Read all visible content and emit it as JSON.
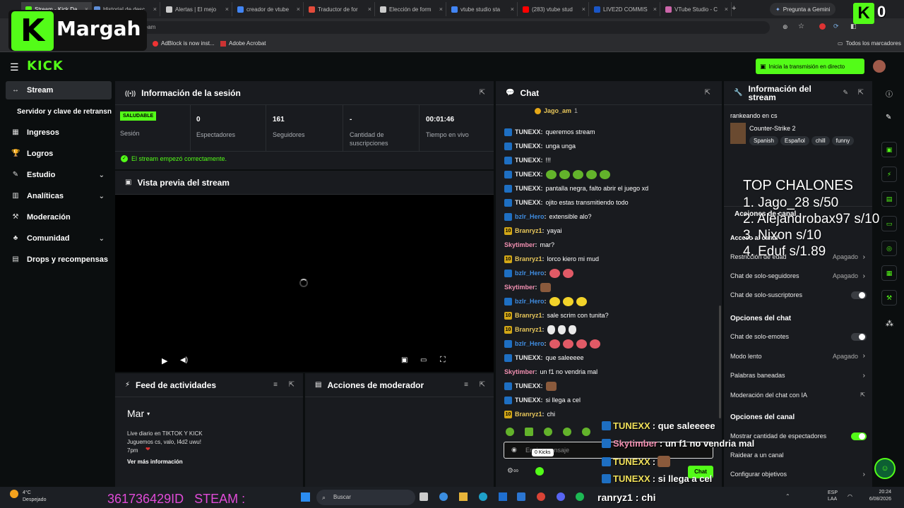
{
  "browser": {
    "tabs": [
      {
        "label": "Stream - Kick Da",
        "color": "#53fc18"
      },
      {
        "label": "Historial de desc",
        "color": "#5f8fd9"
      },
      {
        "label": "Alertas | El mejo",
        "color": "#cccccc"
      },
      {
        "label": "creador de vtube",
        "color": "#4285f4"
      },
      {
        "label": "Traductor de for",
        "color": "#e34b3b"
      },
      {
        "label": "Elección de form",
        "color": "#cccccc"
      },
      {
        "label": "vtube studio sta",
        "color": "#4285f4"
      },
      {
        "label": "(283) vtube stud",
        "color": "#ff0000"
      },
      {
        "label": "LIVE2D COMMIS",
        "color": "#1a56c7"
      },
      {
        "label": "VTube Studio - C",
        "color": "#cc66aa"
      }
    ],
    "gemini": "Pregunta a Gemini",
    "address": "ream",
    "bookmarks": [
      "AdBlock is now inst...",
      "Adobe Acrobat"
    ],
    "all_bookmarks": "Todos los marcadores"
  },
  "overlay": {
    "logo_name": "Margah",
    "corner_zero": "0",
    "top_title": "TOP CHALONES",
    "top_lines": [
      "1. Jago_28 s/50",
      "2. Alejandrobax97 s/10",
      "3. Nixon s/10",
      "4. Eduf s/1.89"
    ],
    "steam_line": "361736429ID   STEAM :",
    "chat_overlay": [
      {
        "user": "TUNEXX",
        "msg": " : que saleeeee",
        "color": "#f0e05a"
      },
      {
        "user": "Skytimber",
        "msg": " : un f1 no vendria mal",
        "color": "#f08fb0"
      },
      {
        "user": "TUNEXX",
        "msg": " : ",
        "color": "#f0e05a"
      },
      {
        "user": "TUNEXX",
        "msg": " : si llega a cel",
        "color": "#f0e05a"
      }
    ],
    "bottom_chat": "ranryz1 : chi"
  },
  "kick": {
    "logo": "KICK",
    "golive": "Inicia la transmisión en directo"
  },
  "sidebar": {
    "items": [
      {
        "label": "Stream",
        "icon": "↔"
      },
      {
        "label": "Servidor y clave de retransn",
        "icon": ""
      },
      {
        "label": "Ingresos",
        "icon": "▦"
      },
      {
        "label": "Logros",
        "icon": "🏆"
      },
      {
        "label": "Estudio",
        "icon": "✎"
      },
      {
        "label": "Analíticas",
        "icon": "▥"
      },
      {
        "label": "Moderación",
        "icon": "⚒"
      },
      {
        "label": "Comunidad",
        "icon": "♣"
      },
      {
        "label": "Drops y recompensas",
        "icon": "▤"
      }
    ]
  },
  "session": {
    "title": "Información de la sesión",
    "health": "SALUDABLE",
    "health_label": "Sesión",
    "stats": [
      {
        "value": "0",
        "label": "Espectadores"
      },
      {
        "value": "161",
        "label": "Seguidores"
      },
      {
        "value": "-",
        "label": "Cantidad de suscripciones"
      },
      {
        "value": "00:01:46",
        "label": "Tiempo en vivo"
      }
    ],
    "status": "El stream empezó correctamente."
  },
  "preview": {
    "title": "Vista previa del stream"
  },
  "activity": {
    "title": "Feed de actividades",
    "month": "Mar",
    "text": "Live diario en TIKTOK Y KICK\nJuguemos cs, valo, l4d2 uwu!\n7pm",
    "more": "Ver más información"
  },
  "modactions": {
    "title": "Acciones de moderador"
  },
  "chat": {
    "title": "Chat",
    "pinned": "Jago_am",
    "pinned_count": "1",
    "messages": [
      {
        "user": "TUNEXX",
        "text": "queremos stream",
        "badge": "b-blue",
        "ucls": "u-white",
        "emotes": []
      },
      {
        "user": "TUNEXX",
        "text": "unga unga",
        "badge": "b-blue",
        "ucls": "u-white",
        "emotes": []
      },
      {
        "user": "TUNEXX",
        "text": "!!!",
        "badge": "b-blue",
        "ucls": "u-white",
        "emotes": []
      },
      {
        "user": "TUNEXX",
        "text": "",
        "badge": "b-blue",
        "ucls": "u-white",
        "emotes": [
          "e-green",
          "e-green",
          "e-green",
          "e-green",
          "e-green"
        ]
      },
      {
        "user": "TUNEXX",
        "text": "pantalla negra, falto abrir el juego xd",
        "badge": "b-blue",
        "ucls": "u-white",
        "emotes": []
      },
      {
        "user": "TUNEXX",
        "text": "ojito estas transmitiendo todo",
        "badge": "b-blue",
        "ucls": "u-white",
        "emotes": []
      },
      {
        "user": "bzlr_Hero",
        "text": "extensible alo?",
        "badge": "b-blue",
        "ucls": "u-blue",
        "emotes": []
      },
      {
        "user": "Branryz1",
        "text": "yayai",
        "badge": "b-gold",
        "ucls": "u-gold",
        "emotes": []
      },
      {
        "user": "Skytimber",
        "text": "mar?",
        "badge": "",
        "ucls": "u-pink",
        "emotes": []
      },
      {
        "user": "Branryz1",
        "text": "lorco kiero mi mud",
        "badge": "b-gold",
        "ucls": "u-gold",
        "emotes": []
      },
      {
        "user": "bzlr_Hero",
        "text": "",
        "badge": "b-blue",
        "ucls": "u-blue",
        "emotes": [
          "e-red",
          "e-red"
        ]
      },
      {
        "user": "Skytimber",
        "text": "",
        "badge": "",
        "ucls": "u-pink",
        "emotes": [
          "e-brown"
        ]
      },
      {
        "user": "bzlr_Hero",
        "text": "",
        "badge": "b-blue",
        "ucls": "u-blue",
        "emotes": [
          "e-yel",
          "e-yel",
          "e-yel"
        ]
      },
      {
        "user": "Branryz1",
        "text": "sale scrim con tunita?",
        "badge": "b-gold",
        "ucls": "u-gold",
        "emotes": []
      },
      {
        "user": "Branryz1",
        "text": "",
        "badge": "b-gold",
        "ucls": "u-gold",
        "emotes": [
          "e-white",
          "e-white",
          "e-white"
        ]
      },
      {
        "user": "bzlr_Hero",
        "text": "",
        "badge": "b-blue",
        "ucls": "u-blue",
        "emotes": [
          "e-red",
          "e-red",
          "e-red",
          "e-red"
        ]
      },
      {
        "user": "TUNEXX",
        "text": "que saleeeee",
        "badge": "b-blue",
        "ucls": "u-white",
        "emotes": []
      },
      {
        "user": "Skytimber",
        "text": "un f1 no vendria mal",
        "badge": "",
        "ucls": "u-pink",
        "emotes": []
      },
      {
        "user": "TUNEXX",
        "text": "",
        "badge": "b-blue",
        "ucls": "u-white",
        "emotes": [
          "e-brown"
        ]
      },
      {
        "user": "TUNEXX",
        "text": "si llega a cel",
        "badge": "b-blue",
        "ucls": "u-white",
        "emotes": []
      },
      {
        "user": "Branryz1",
        "text": "chi",
        "badge": "b-gold",
        "ucls": "u-gold",
        "emotes": []
      }
    ],
    "input_placeholder": "Enviar mensaje",
    "kicks": "0 Kicks",
    "send": "Chat"
  },
  "streaminfo": {
    "title": "Información del stream",
    "stream_title": "rankeando en cs",
    "game": "Counter-Strike 2",
    "tags": [
      "Spanish",
      "Español",
      "chill",
      "funny"
    ],
    "channel_actions": "Acciones de canal",
    "access": "Acceso al canal",
    "rows": [
      {
        "label": "Restricción de edad",
        "value": "Apagado",
        "kind": "arrow"
      },
      {
        "label": "Chat de solo-seguidores",
        "value": "Apagado",
        "kind": "arrow"
      },
      {
        "label": "Chat de solo-suscriptores",
        "value": "",
        "kind": "toggle"
      }
    ],
    "chat_options": "Opciones del chat",
    "rows2": [
      {
        "label": "Chat de solo-emotes",
        "value": "",
        "kind": "toggle"
      },
      {
        "label": "Modo lento",
        "value": "Apagado",
        "kind": "arrow"
      },
      {
        "label": "Palabras baneadas",
        "value": "",
        "kind": "arrow"
      },
      {
        "label": "Moderación del chat con IA",
        "value": "",
        "kind": "ext"
      }
    ],
    "channel_options": "Opciones del canal",
    "rows3": [
      {
        "label": "Mostrar cantidad de espectadores",
        "value": "",
        "kind": "toggle-on"
      },
      {
        "label": "Raidear a un canal",
        "value": "",
        "kind": "none"
      },
      {
        "label": "Configurar objetivos",
        "value": "",
        "kind": "arrow"
      }
    ]
  },
  "taskbar": {
    "weather_temp": "4°C",
    "weather_desc": "Despejado",
    "search": "Buscar",
    "lang": "ESP\nLAA",
    "time": "20:24",
    "date": "6/08/2026"
  }
}
